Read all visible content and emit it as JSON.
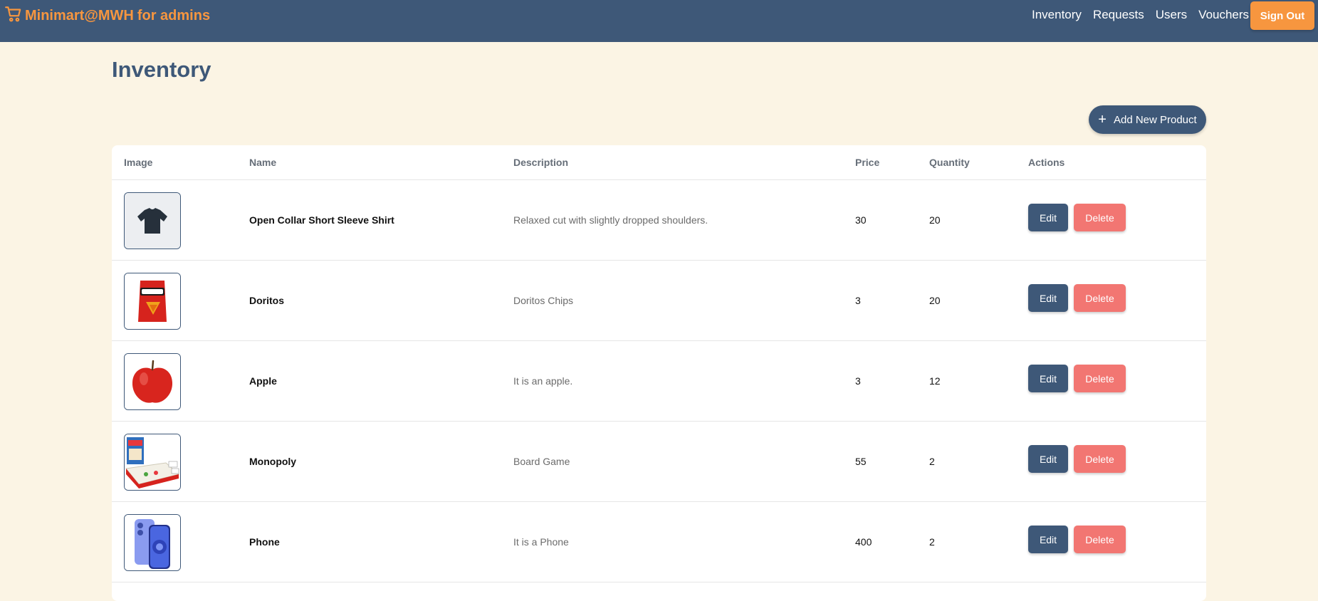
{
  "brand": {
    "name": "Minimart@MWH",
    "suffix": "for admins",
    "icon": "cart-icon"
  },
  "nav": {
    "links": [
      "Inventory",
      "Requests",
      "Users",
      "Vouchers"
    ],
    "signout_label": "Sign Out"
  },
  "page": {
    "title": "Inventory",
    "add_button_label": "Add New Product"
  },
  "table": {
    "headers": [
      "Image",
      "Name",
      "Description",
      "Price",
      "Quantity",
      "Actions"
    ],
    "edit_label": "Edit",
    "delete_label": "Delete",
    "rows": [
      {
        "image": "shirt-image",
        "name": "Open Collar Short Sleeve Shirt",
        "description": "Relaxed cut with slightly dropped shoulders.",
        "price": "30",
        "quantity": "20"
      },
      {
        "image": "doritos-image",
        "name": "Doritos",
        "description": "Doritos Chips",
        "price": "3",
        "quantity": "20"
      },
      {
        "image": "apple-image",
        "name": "Apple",
        "description": "It is an apple.",
        "price": "3",
        "quantity": "12"
      },
      {
        "image": "monopoly-image",
        "name": "Monopoly",
        "description": "Board Game",
        "price": "55",
        "quantity": "2"
      },
      {
        "image": "phone-image",
        "name": "Phone",
        "description": "It is a Phone",
        "price": "400",
        "quantity": "2"
      }
    ]
  },
  "colors": {
    "navbar": "#3e5878",
    "accent": "#f7963f",
    "background": "#fbf4e4",
    "delete": "#f27672"
  }
}
